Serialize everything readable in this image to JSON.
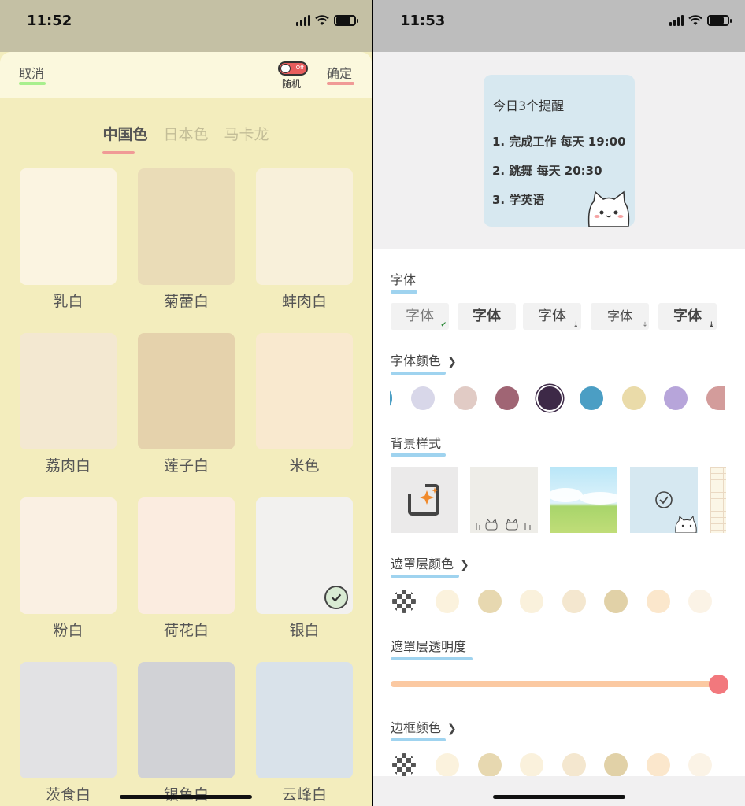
{
  "left": {
    "status_time": "11:52",
    "header": {
      "cancel": "取消",
      "random": "随机",
      "toggle": "Off",
      "confirm": "确定"
    },
    "tabs": [
      {
        "label": "中国色"
      },
      {
        "label": "日本色"
      },
      {
        "label": "马卡龙"
      }
    ],
    "colors": [
      {
        "name": "乳白",
        "color": "#fbf4e1"
      },
      {
        "name": "菊蕾白",
        "color": "#eadcb7"
      },
      {
        "name": "蚌肉白",
        "color": "#f8f0da"
      },
      {
        "name": "荔肉白",
        "color": "#f3e8d1"
      },
      {
        "name": "莲子白",
        "color": "#e5d2ac"
      },
      {
        "name": "米色",
        "color": "#f9e9cf"
      },
      {
        "name": "粉白",
        "color": "#faf0e3"
      },
      {
        "name": "荷花白",
        "color": "#fbece0"
      },
      {
        "name": "银白",
        "color": "#f2f1ef",
        "selected": true
      },
      {
        "name": "茨食白",
        "color": "#e2e2e4"
      },
      {
        "name": "银鱼白",
        "color": "#d1d2d6"
      },
      {
        "name": "云峰白",
        "color": "#d9e2ea"
      }
    ]
  },
  "right": {
    "status_time": "11:53",
    "widget": {
      "title": "今日3个提醒",
      "items": [
        "1. 完成工作 每天 19:00",
        "2. 跳舞 每天 20:30",
        "3. 学英语"
      ]
    },
    "sections": {
      "font": "字体",
      "font_color": "字体颜色",
      "background": "背景样式",
      "mask_color": "遮罩层颜色",
      "mask_opacity": "遮罩层透明度",
      "border_color": "边框颜色"
    },
    "font_options": [
      "字体",
      "字体",
      "字体",
      "字体",
      "字体"
    ],
    "font_colors": [
      "#d8d7e9",
      "#e1cbc5",
      "#a06574",
      "#3d2947",
      "#4b9ec4",
      "#eadba9",
      "#b7a5da",
      "#d39c9b"
    ],
    "mask_colors": [
      "#fbf2dd",
      "#e7d8b0",
      "#faf1dc",
      "#f4e7cf",
      "#e1d1a7",
      "#fbe7cc",
      "#fbf3e6"
    ],
    "border_colors": [
      "#fbf2dd",
      "#e7d8b0",
      "#faf1dc",
      "#f4e7cf",
      "#e1d1a7",
      "#fbe7cc",
      "#fbf3e6"
    ],
    "mask_opacity": 1.0
  }
}
